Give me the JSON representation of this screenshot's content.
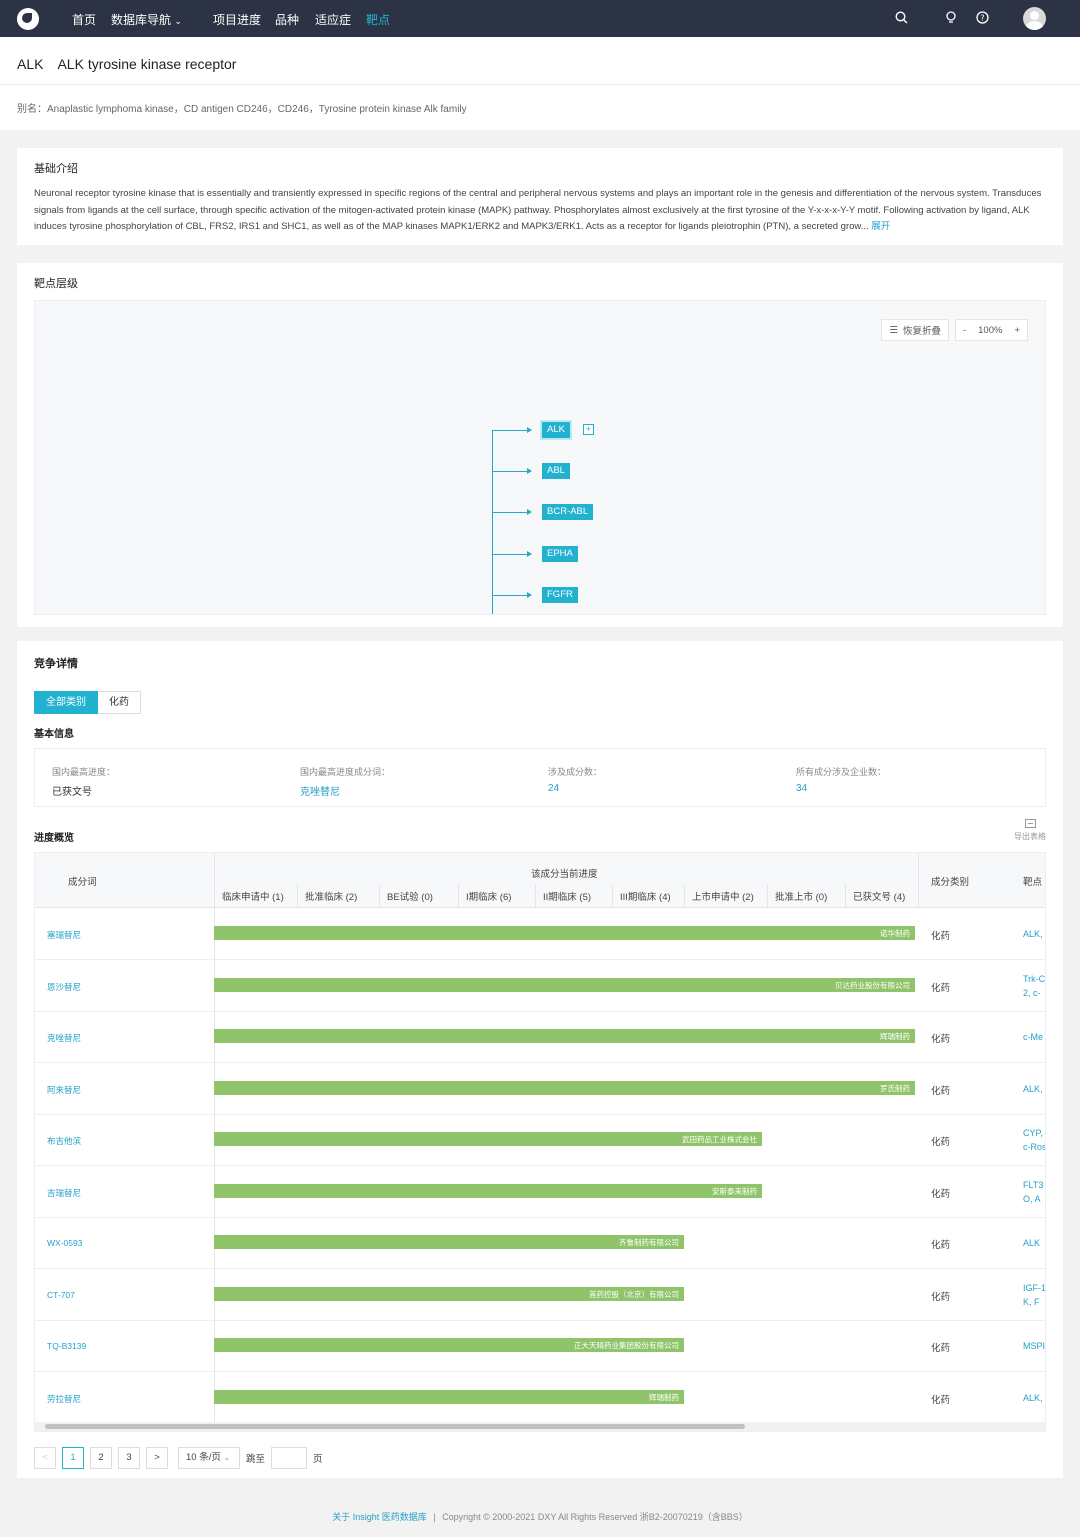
{
  "nav": {
    "items": [
      "首页",
      "数据库导航",
      "项目进度",
      "品种",
      "适应症",
      "靶点"
    ],
    "dropdown_caret": "⌄",
    "icons": [
      "search-icon",
      "lightbulb-icon",
      "help-icon",
      "avatar"
    ]
  },
  "header": {
    "symbol": "ALK",
    "name": "ALK tyrosine kinase receptor",
    "alias": "别名：Anaplastic lymphoma kinase，CD antigen CD246，CD246，Tyrosine protein kinase Alk family"
  },
  "intro": {
    "title": "基础介绍",
    "text": "Neuronal receptor tyrosine kinase that is essentially and transiently expressed in specific regions of the central and peripheral nervous systems and plays an important role in the genesis and differentiation of the nervous system. Transduces signals from ligands at the cell surface, through specific activation of the mitogen-activated protein kinase (MAPK) pathway. Phosphorylates almost exclusively at the first tyrosine of the Y-x-x-x-Y-Y motif. Following activation by ligand, ALK induces tyrosine phosphorylation of CBL, FRS2, IRS1 and SHC1, as well as of the MAP kinases MAPK1/ERK2 and MAPK3/ERK1. Acts as a receptor for ligands pleiotrophin (PTN), a secreted grow...",
    "expand": "展开"
  },
  "hierarchy": {
    "title": "靶点层级",
    "restore": "恢复折叠",
    "zoom_minus": "-",
    "zoom": "100%",
    "zoom_plus": "+",
    "nodes": [
      "ALK",
      "ABL",
      "BCR-ABL",
      "EPHA",
      "FGFR"
    ],
    "expand_symbol": "+"
  },
  "competition": {
    "title": "竞争详情",
    "tabs": [
      "全部类别",
      "化药"
    ],
    "basic_info_title": "基本信息",
    "basic_info": [
      {
        "label": "国内最高进度：",
        "value": "已获文号",
        "link": false
      },
      {
        "label": "国内最高进度成分词：",
        "value": "克唑替尼",
        "link": true
      },
      {
        "label": "涉及成分数：",
        "value": "24",
        "link": true
      },
      {
        "label": "所有成分涉及企业数：",
        "value": "34",
        "link": true
      }
    ],
    "progress_title": "进度概览",
    "export": "导出表格",
    "table": {
      "col_ingredient": "成分词",
      "col_progress": "该成分当前进度",
      "col_category": "成分类别",
      "col_target": "靶点",
      "stages": [
        "临床申请中 (1)",
        "批准临床 (2)",
        "BE试验 (0)",
        "I期临床 (6)",
        "II期临床 (5)",
        "III期临床 (4)",
        "上市申请中 (2)",
        "批准上市 (0)",
        "已获文号 (4)"
      ],
      "rows": [
        {
          "name": "塞瑞替尼",
          "progress": 0.996,
          "company": "诺华制药",
          "category": "化药",
          "target": [
            "ALK,"
          ]
        },
        {
          "name": "恩沙替尼",
          "progress": 0.996,
          "company": "贝达药业股份有限公司",
          "category": "化药",
          "target": [
            "Trk-C",
            "2, c-"
          ]
        },
        {
          "name": "克唑替尼",
          "progress": 0.996,
          "company": "辉瑞制药",
          "category": "化药",
          "target": [
            "c-Me"
          ]
        },
        {
          "name": "阿来替尼",
          "progress": 0.996,
          "company": "罗氏制药",
          "category": "化药",
          "target": [
            "ALK,"
          ]
        },
        {
          "name": "布吉他滨",
          "progress": 0.778,
          "company": "武田药品工业株式会社",
          "category": "化药",
          "target": [
            "CYP,",
            "c-Ros"
          ]
        },
        {
          "name": "吉瑞替尼",
          "progress": 0.778,
          "company": "安斯泰来制药",
          "category": "化药",
          "target": [
            "FLT3",
            "O, A"
          ]
        },
        {
          "name": "WX-0593",
          "progress": 0.667,
          "company": "齐鲁制药有限公司",
          "category": "化药",
          "target": [
            "ALK"
          ]
        },
        {
          "name": "CT-707",
          "progress": 0.667,
          "company": "首药控股（北京）有限公司",
          "category": "化药",
          "target": [
            "IGF-1",
            "K, F"
          ]
        },
        {
          "name": "TQ-B3139",
          "progress": 0.667,
          "company": "正大天晴药业集团股份有限公司",
          "category": "化药",
          "target": [
            "MSPI"
          ]
        },
        {
          "name": "劳拉替尼",
          "progress": 0.667,
          "company": "辉瑞制药",
          "category": "化药",
          "target": [
            "ALK,"
          ]
        }
      ]
    },
    "pagination": {
      "prev": "<",
      "pages": [
        "1",
        "2",
        "3"
      ],
      "current": "1",
      "next": ">",
      "page_size": "10 条/页",
      "jump_label": "跳至",
      "page_unit": "页"
    }
  },
  "footer": {
    "link": "关于 Insight 医药数据库",
    "separator": "|",
    "copyright": "Copyright © 2000-2021 DXY All Rights Reserved  浙B2-20070219（含BBS）"
  },
  "colors": {
    "nav_bg": "#2c3344",
    "accent": "#22b2cf",
    "bar": "#8fc46a",
    "link": "#24a0c7"
  }
}
